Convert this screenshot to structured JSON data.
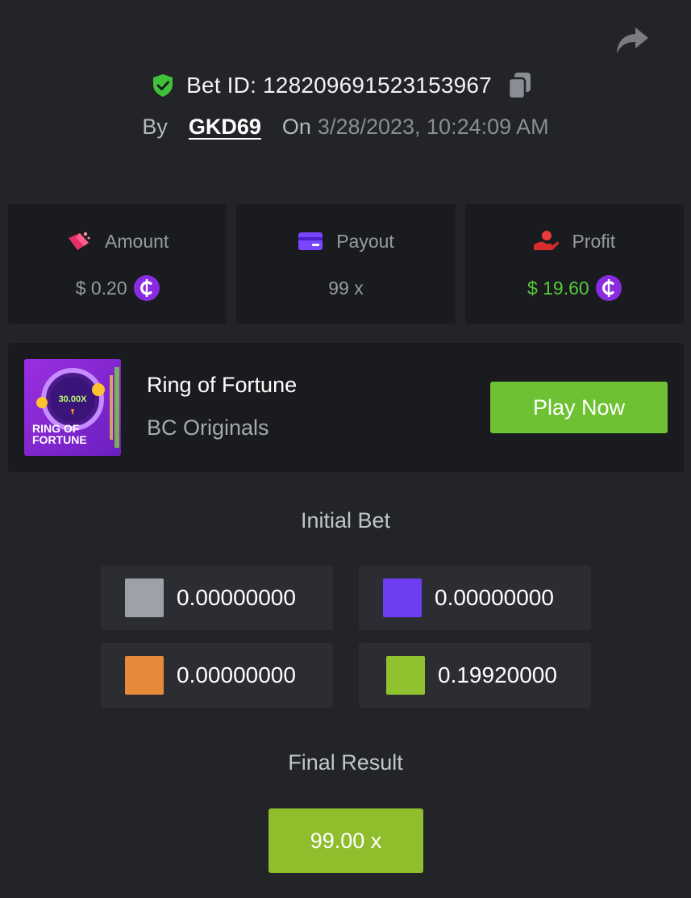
{
  "header": {
    "bet_id": "Bet ID: 128209691523153967",
    "by_label": "By",
    "username": "GKD69",
    "on_label": "On",
    "datetime": "3/28/2023, 10:24:09 AM"
  },
  "stats": {
    "amount": {
      "label": "Amount",
      "value": "$ 0.20",
      "icon": "money-bag-icon"
    },
    "payout": {
      "label": "Payout",
      "value": "99 x",
      "icon": "card-icon"
    },
    "profit": {
      "label": "Profit",
      "value": "$ 19.60",
      "icon": "hand-coin-icon"
    }
  },
  "game": {
    "thumb_multiplier": "30.00X",
    "thumb_line1": "RING OF",
    "thumb_line2": "FORTUNE",
    "title": "Ring of Fortune",
    "subtitle": "BC Originals",
    "play_label": "Play Now"
  },
  "initial_bet": {
    "title": "Initial Bet",
    "bets": [
      {
        "color": "#9ea1a7",
        "value": "0.00000000"
      },
      {
        "color": "#6c3ef0",
        "value": "0.00000000"
      },
      {
        "color": "#e7883a",
        "value": "0.00000000"
      },
      {
        "color": "#90c12f",
        "value": "0.19920000"
      }
    ]
  },
  "final_result": {
    "title": "Final Result",
    "value": "99.00 x",
    "color": "#8fbd2c"
  },
  "colors": {
    "background": "#232428",
    "panel": "#1a1b1e",
    "accent_green": "#6ec132",
    "profit_green": "#56c93e"
  }
}
